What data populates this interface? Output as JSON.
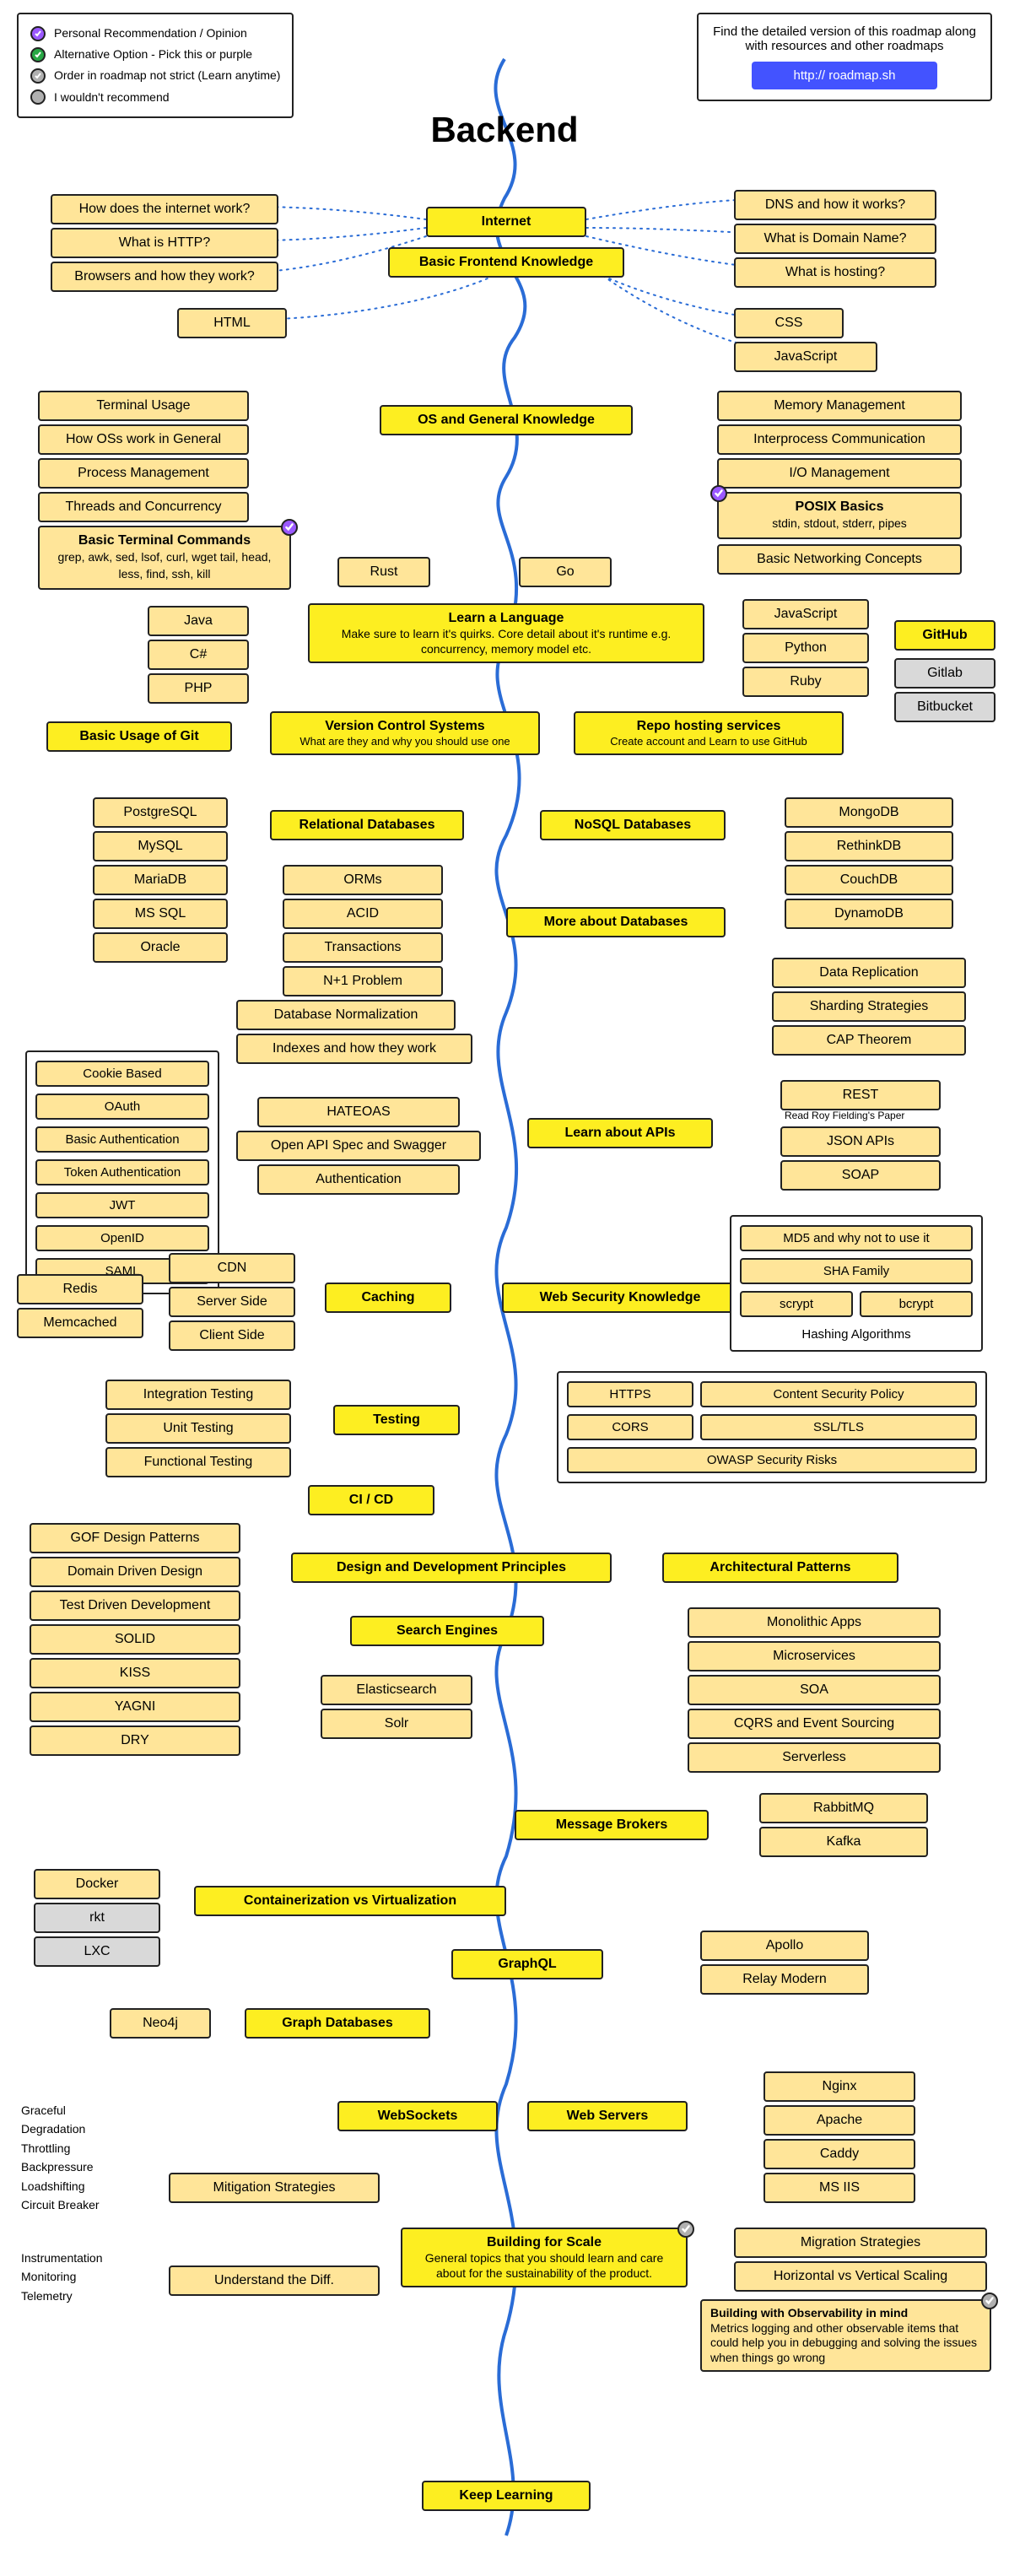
{
  "title": "Backend",
  "legend": {
    "purple": "Personal Recommendation / Opinion",
    "green": "Alternative Option - Pick this or purple",
    "grey": "Order in roadmap not strict (Learn anytime)",
    "greyx": "I wouldn't recommend"
  },
  "promo": {
    "text": "Find the detailed version of this roadmap along with resources and other roadmaps",
    "btn": "http:// roadmap.sh"
  },
  "groups": {
    "hashing_title": "Hashing Algorithms",
    "hashing": {
      "md5": "MD5 and why not to use it",
      "sha": "SHA Family",
      "scrypt": "scrypt",
      "bcrypt": "bcrypt"
    },
    "sec": {
      "https": "HTTPS",
      "cors": "CORS",
      "csp": "Content Security Policy",
      "ssl": "SSL/TLS",
      "owasp": "OWASP Security Risks"
    }
  },
  "plainlists": {
    "mitigation": [
      "Graceful",
      "Degradation",
      "Throttling",
      "Backpressure",
      "Loadshifting",
      "Circuit Breaker"
    ],
    "understand": [
      "Instrumentation",
      "Monitoring",
      "Telemetry"
    ]
  },
  "rest_note": "Read Roy Fielding's Paper",
  "nodes": {
    "internet": "Internet",
    "bfk": "Basic Frontend Knowledge",
    "howinternet": "How does the internet work?",
    "whathttp": "What is HTTP?",
    "browsers": "Browsers and how they work?",
    "dns": "DNS and how it works?",
    "domain": "What is Domain Name?",
    "hosting": "What is hosting?",
    "html": "HTML",
    "css": "CSS",
    "js": "JavaScript",
    "osgen": "OS and General Knowledge",
    "terminal": "Terminal Usage",
    "howos": "How OSs work in General",
    "procmgmt": "Process Management",
    "threads": "Threads and Concurrency",
    "btc_title": "Basic Terminal Commands",
    "btc_sub": "grep, awk, sed, lsof, curl, wget tail, head, less, find, ssh, kill",
    "memmgmt": "Memory Management",
    "ipc": "Interprocess Communication",
    "io": "I/O Management",
    "posix_title": "POSIX Basics",
    "posix_sub": "stdin, stdout, stderr, pipes",
    "netconcepts": "Basic Networking Concepts",
    "rust": "Rust",
    "go": "Go",
    "lang_title": "Learn a Language",
    "lang_sub": "Make sure to learn it's quirks. Core detail about it's runtime e.g. concurrency, memory model etc.",
    "java": "Java",
    "csharp": "C#",
    "php": "PHP",
    "jslang": "JavaScript",
    "python": "Python",
    "ruby": "Ruby",
    "github": "GitHub",
    "gitlab": "Gitlab",
    "bitbucket": "Bitbucket",
    "basicgit": "Basic Usage of Git",
    "vcs_title": "Version Control Systems",
    "vcs_sub": "What are they and why you should use one",
    "repo_title": "Repo hosting services",
    "repo_sub": "Create account and Learn to use GitHub",
    "reldb": "Relational Databases",
    "nosql": "NoSQL Databases",
    "pg": "PostgreSQL",
    "mysql": "MySQL",
    "maria": "MariaDB",
    "mssql": "MS SQL",
    "oracle": "Oracle",
    "mongo": "MongoDB",
    "rethink": "RethinkDB",
    "couch": "CouchDB",
    "dynamo": "DynamoDB",
    "moredb": "More about Databases",
    "orms": "ORMs",
    "acid": "ACID",
    "txn": "Transactions",
    "n1": "N+1 Problem",
    "dbnorm": "Database Normalization",
    "indexes": "Indexes and how they work",
    "datarep": "Data Replication",
    "shard": "Sharding Strategies",
    "cap": "CAP Theorem",
    "apis": "Learn about APIs",
    "hateoas": "HATEOAS",
    "openapi": "Open API Spec and Swagger",
    "auth": "Authentication",
    "rest": "REST",
    "jsonapi": "JSON APIs",
    "soap": "SOAP",
    "cookie": "Cookie Based",
    "oauth": "OAuth",
    "basicauth": "Basic Authentication",
    "tokenauth": "Token Authentication",
    "jwt": "JWT",
    "openid": "OpenID",
    "saml": "SAML",
    "caching": "Caching",
    "websec": "Web Security Knowledge",
    "cdn": "CDN",
    "serverside": "Server Side",
    "clientside": "Client Side",
    "redis": "Redis",
    "memcached": "Memcached",
    "testing": "Testing",
    "integration": "Integration Testing",
    "unit": "Unit Testing",
    "func": "Functional Testing",
    "cicd": "CI / CD",
    "ddp": "Design and Development Principles",
    "arch": "Architectural Patterns",
    "gof": "GOF Design Patterns",
    "ddd": "Domain Driven Design",
    "tdd": "Test Driven Development",
    "solid": "SOLID",
    "kiss": "KISS",
    "yagni": "YAGNI",
    "dry": "DRY",
    "mono": "Monolithic Apps",
    "micro": "Microservices",
    "soa": "SOA",
    "cqrs": "CQRS and Event Sourcing",
    "serverless": "Serverless",
    "search": "Search Engines",
    "elastic": "Elasticsearch",
    "solr": "Solr",
    "msgbrokers": "Message Brokers",
    "rabbit": "RabbitMQ",
    "kafka": "Kafka",
    "contvirt": "Containerization vs Virtualization",
    "docker": "Docker",
    "rkt": "rkt",
    "lxc": "LXC",
    "graphql": "GraphQL",
    "apollo": "Apollo",
    "relay": "Relay Modern",
    "graphdb": "Graph Databases",
    "neo4j": "Neo4j",
    "websockets": "WebSockets",
    "webservers": "Web Servers",
    "nginx": "Nginx",
    "apache": "Apache",
    "caddy": "Caddy",
    "msiis": "MS IIS",
    "mitigation": "Mitigation Strategies",
    "understand": "Understand the Diff.",
    "bfs_title": "Building for Scale",
    "bfs_sub": "General topics that you should learn and care about for the sustainability of the product.",
    "migration": "Migration Strategies",
    "hvs": "Horizontal vs Vertical Scaling",
    "obs_title": "Building with Observability in mind",
    "obs_sub": "Metrics logging and other observable items that could help you in debugging and solving the issues when things go wrong",
    "keep": "Keep Learning"
  }
}
